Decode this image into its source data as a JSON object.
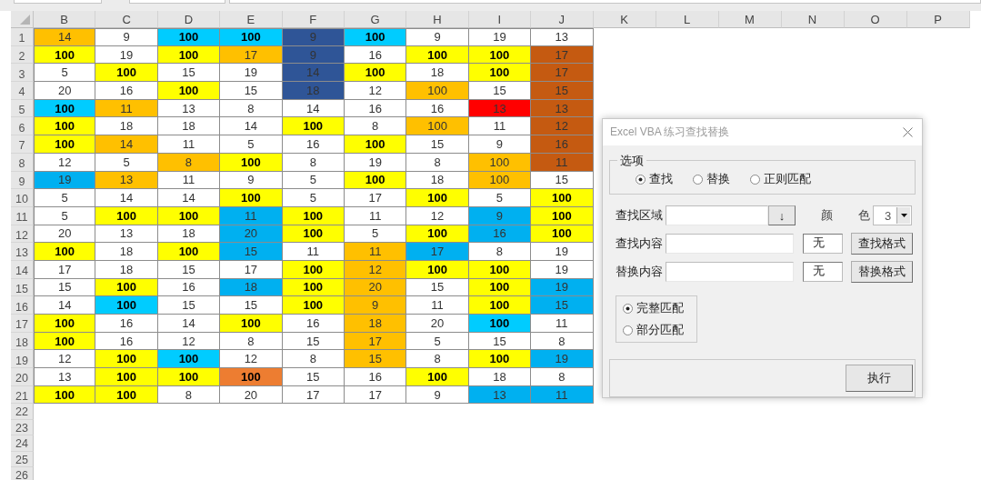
{
  "sheet": {
    "columns": [
      "B",
      "C",
      "D",
      "E",
      "F",
      "G",
      "H",
      "I",
      "J",
      "K",
      "L",
      "M",
      "N",
      "O",
      "P"
    ],
    "row_numbers": [
      "1",
      "2",
      "3",
      "4",
      "5",
      "6",
      "7",
      "8",
      "9",
      "10",
      "11",
      "12",
      "13",
      "14",
      "15",
      "16",
      "17",
      "18",
      "19",
      "20",
      "21",
      "22",
      "23",
      "24",
      "25",
      "26"
    ],
    "rows": [
      [
        {
          "text": "14",
          "color": "#ffc000",
          "bold": false
        },
        {
          "text": "9",
          "color": "#ffffff",
          "bold": false
        },
        {
          "text": "100",
          "color": "#00ccff",
          "bold": true
        },
        {
          "text": "100",
          "color": "#00ccff",
          "bold": true
        },
        {
          "text": "9",
          "color": "#2f5597",
          "bold": false
        },
        {
          "text": "100",
          "color": "#00ccff",
          "bold": true
        },
        {
          "text": "9",
          "color": "#ffffff",
          "bold": false
        },
        {
          "text": "19",
          "color": "#ffffff",
          "bold": false
        },
        {
          "text": "13",
          "color": "#ffffff",
          "bold": false
        }
      ],
      [
        {
          "text": "100",
          "color": "#ffff00",
          "bold": true
        },
        {
          "text": "19",
          "color": "#ffffff",
          "bold": false
        },
        {
          "text": "100",
          "color": "#ffff00",
          "bold": true
        },
        {
          "text": "17",
          "color": "#ffc000",
          "bold": false
        },
        {
          "text": "9",
          "color": "#2f5597",
          "bold": false
        },
        {
          "text": "16",
          "color": "#ffffff",
          "bold": false
        },
        {
          "text": "100",
          "color": "#ffff00",
          "bold": true
        },
        {
          "text": "100",
          "color": "#ffff00",
          "bold": true
        },
        {
          "text": "17",
          "color": "#c55a11",
          "bold": false
        }
      ],
      [
        {
          "text": "5",
          "color": "#ffffff",
          "bold": false
        },
        {
          "text": "100",
          "color": "#ffff00",
          "bold": true
        },
        {
          "text": "15",
          "color": "#ffffff",
          "bold": false
        },
        {
          "text": "19",
          "color": "#ffffff",
          "bold": false
        },
        {
          "text": "14",
          "color": "#2f5597",
          "bold": false
        },
        {
          "text": "100",
          "color": "#ffff00",
          "bold": true
        },
        {
          "text": "18",
          "color": "#ffffff",
          "bold": false
        },
        {
          "text": "100",
          "color": "#ffff00",
          "bold": true
        },
        {
          "text": "17",
          "color": "#c55a11",
          "bold": false
        }
      ],
      [
        {
          "text": "20",
          "color": "#ffffff",
          "bold": false
        },
        {
          "text": "16",
          "color": "#ffffff",
          "bold": false
        },
        {
          "text": "100",
          "color": "#ffff00",
          "bold": true
        },
        {
          "text": "15",
          "color": "#ffffff",
          "bold": false
        },
        {
          "text": "18",
          "color": "#2f5597",
          "bold": false
        },
        {
          "text": "12",
          "color": "#ffffff",
          "bold": false
        },
        {
          "text": "100",
          "color": "#ffc000",
          "bold": false
        },
        {
          "text": "15",
          "color": "#ffffff",
          "bold": false
        },
        {
          "text": "15",
          "color": "#c55a11",
          "bold": false
        }
      ],
      [
        {
          "text": "100",
          "color": "#00ccff",
          "bold": true
        },
        {
          "text": "11",
          "color": "#ffc000",
          "bold": false
        },
        {
          "text": "13",
          "color": "#ffffff",
          "bold": false
        },
        {
          "text": "8",
          "color": "#ffffff",
          "bold": false
        },
        {
          "text": "14",
          "color": "#ffffff",
          "bold": false
        },
        {
          "text": "16",
          "color": "#ffffff",
          "bold": false
        },
        {
          "text": "16",
          "color": "#ffffff",
          "bold": false
        },
        {
          "text": "13",
          "color": "#ff0000",
          "bold": false
        },
        {
          "text": "13",
          "color": "#c55a11",
          "bold": false
        }
      ],
      [
        {
          "text": "100",
          "color": "#ffff00",
          "bold": true
        },
        {
          "text": "18",
          "color": "#ffffff",
          "bold": false
        },
        {
          "text": "18",
          "color": "#ffffff",
          "bold": false
        },
        {
          "text": "14",
          "color": "#ffffff",
          "bold": false
        },
        {
          "text": "100",
          "color": "#ffff00",
          "bold": true
        },
        {
          "text": "8",
          "color": "#ffffff",
          "bold": false
        },
        {
          "text": "100",
          "color": "#ffc000",
          "bold": false
        },
        {
          "text": "11",
          "color": "#ffffff",
          "bold": false
        },
        {
          "text": "12",
          "color": "#c55a11",
          "bold": false
        }
      ],
      [
        {
          "text": "100",
          "color": "#ffff00",
          "bold": true
        },
        {
          "text": "14",
          "color": "#ffc000",
          "bold": false
        },
        {
          "text": "11",
          "color": "#ffffff",
          "bold": false
        },
        {
          "text": "5",
          "color": "#ffffff",
          "bold": false
        },
        {
          "text": "16",
          "color": "#ffffff",
          "bold": false
        },
        {
          "text": "100",
          "color": "#ffff00",
          "bold": true
        },
        {
          "text": "15",
          "color": "#ffffff",
          "bold": false
        },
        {
          "text": "9",
          "color": "#ffffff",
          "bold": false
        },
        {
          "text": "16",
          "color": "#c55a11",
          "bold": false
        }
      ],
      [
        {
          "text": "12",
          "color": "#ffffff",
          "bold": false
        },
        {
          "text": "5",
          "color": "#ffffff",
          "bold": false
        },
        {
          "text": "8",
          "color": "#ffc000",
          "bold": false
        },
        {
          "text": "100",
          "color": "#ffff00",
          "bold": true
        },
        {
          "text": "8",
          "color": "#ffffff",
          "bold": false
        },
        {
          "text": "19",
          "color": "#ffffff",
          "bold": false
        },
        {
          "text": "8",
          "color": "#ffffff",
          "bold": false
        },
        {
          "text": "100",
          "color": "#ffc000",
          "bold": false
        },
        {
          "text": "11",
          "color": "#c55a11",
          "bold": false
        }
      ],
      [
        {
          "text": "19",
          "color": "#00b0f0",
          "bold": false
        },
        {
          "text": "13",
          "color": "#ffc000",
          "bold": false
        },
        {
          "text": "11",
          "color": "#ffffff",
          "bold": false
        },
        {
          "text": "9",
          "color": "#ffffff",
          "bold": false
        },
        {
          "text": "5",
          "color": "#ffffff",
          "bold": false
        },
        {
          "text": "100",
          "color": "#ffff00",
          "bold": true
        },
        {
          "text": "18",
          "color": "#ffffff",
          "bold": false
        },
        {
          "text": "100",
          "color": "#ffc000",
          "bold": false
        },
        {
          "text": "15",
          "color": "#ffffff",
          "bold": false
        }
      ],
      [
        {
          "text": "5",
          "color": "#ffffff",
          "bold": false
        },
        {
          "text": "14",
          "color": "#ffffff",
          "bold": false
        },
        {
          "text": "14",
          "color": "#ffffff",
          "bold": false
        },
        {
          "text": "100",
          "color": "#ffff00",
          "bold": true
        },
        {
          "text": "5",
          "color": "#ffffff",
          "bold": false
        },
        {
          "text": "17",
          "color": "#ffffff",
          "bold": false
        },
        {
          "text": "100",
          "color": "#ffff00",
          "bold": true
        },
        {
          "text": "5",
          "color": "#ffffff",
          "bold": false
        },
        {
          "text": "100",
          "color": "#ffff00",
          "bold": true
        }
      ],
      [
        {
          "text": "5",
          "color": "#ffffff",
          "bold": false
        },
        {
          "text": "100",
          "color": "#ffff00",
          "bold": true
        },
        {
          "text": "100",
          "color": "#ffff00",
          "bold": true
        },
        {
          "text": "11",
          "color": "#00b0f0",
          "bold": false
        },
        {
          "text": "100",
          "color": "#ffff00",
          "bold": true
        },
        {
          "text": "11",
          "color": "#ffffff",
          "bold": false
        },
        {
          "text": "12",
          "color": "#ffffff",
          "bold": false
        },
        {
          "text": "9",
          "color": "#00b0f0",
          "bold": false
        },
        {
          "text": "100",
          "color": "#ffff00",
          "bold": true
        }
      ],
      [
        {
          "text": "20",
          "color": "#ffffff",
          "bold": false
        },
        {
          "text": "13",
          "color": "#ffffff",
          "bold": false
        },
        {
          "text": "18",
          "color": "#ffffff",
          "bold": false
        },
        {
          "text": "20",
          "color": "#00b0f0",
          "bold": false
        },
        {
          "text": "100",
          "color": "#ffff00",
          "bold": true
        },
        {
          "text": "5",
          "color": "#ffffff",
          "bold": false
        },
        {
          "text": "100",
          "color": "#ffff00",
          "bold": true
        },
        {
          "text": "16",
          "color": "#00b0f0",
          "bold": false
        },
        {
          "text": "100",
          "color": "#ffff00",
          "bold": true
        }
      ],
      [
        {
          "text": "100",
          "color": "#ffff00",
          "bold": true
        },
        {
          "text": "18",
          "color": "#ffffff",
          "bold": false
        },
        {
          "text": "100",
          "color": "#ffff00",
          "bold": true
        },
        {
          "text": "15",
          "color": "#00b0f0",
          "bold": false
        },
        {
          "text": "11",
          "color": "#ffffff",
          "bold": false
        },
        {
          "text": "11",
          "color": "#ffc000",
          "bold": false
        },
        {
          "text": "17",
          "color": "#00b0f0",
          "bold": false
        },
        {
          "text": "8",
          "color": "#ffffff",
          "bold": false
        },
        {
          "text": "19",
          "color": "#ffffff",
          "bold": false
        }
      ],
      [
        {
          "text": "17",
          "color": "#ffffff",
          "bold": false
        },
        {
          "text": "18",
          "color": "#ffffff",
          "bold": false
        },
        {
          "text": "15",
          "color": "#ffffff",
          "bold": false
        },
        {
          "text": "17",
          "color": "#ffffff",
          "bold": false
        },
        {
          "text": "100",
          "color": "#ffff00",
          "bold": true
        },
        {
          "text": "12",
          "color": "#ffc000",
          "bold": false
        },
        {
          "text": "100",
          "color": "#ffff00",
          "bold": true
        },
        {
          "text": "100",
          "color": "#ffff00",
          "bold": true
        },
        {
          "text": "19",
          "color": "#ffffff",
          "bold": false
        }
      ],
      [
        {
          "text": "15",
          "color": "#ffffff",
          "bold": false
        },
        {
          "text": "100",
          "color": "#ffff00",
          "bold": true
        },
        {
          "text": "16",
          "color": "#ffffff",
          "bold": false
        },
        {
          "text": "18",
          "color": "#00b0f0",
          "bold": false
        },
        {
          "text": "100",
          "color": "#ffff00",
          "bold": true
        },
        {
          "text": "20",
          "color": "#ffc000",
          "bold": false
        },
        {
          "text": "15",
          "color": "#ffffff",
          "bold": false
        },
        {
          "text": "100",
          "color": "#ffff00",
          "bold": true
        },
        {
          "text": "19",
          "color": "#00b0f0",
          "bold": false
        }
      ],
      [
        {
          "text": "14",
          "color": "#ffffff",
          "bold": false
        },
        {
          "text": "100",
          "color": "#00ccff",
          "bold": true
        },
        {
          "text": "15",
          "color": "#ffffff",
          "bold": false
        },
        {
          "text": "15",
          "color": "#ffffff",
          "bold": false
        },
        {
          "text": "100",
          "color": "#ffff00",
          "bold": true
        },
        {
          "text": "9",
          "color": "#ffc000",
          "bold": false
        },
        {
          "text": "11",
          "color": "#ffffff",
          "bold": false
        },
        {
          "text": "100",
          "color": "#ffff00",
          "bold": true
        },
        {
          "text": "15",
          "color": "#00b0f0",
          "bold": false
        }
      ],
      [
        {
          "text": "100",
          "color": "#ffff00",
          "bold": true
        },
        {
          "text": "16",
          "color": "#ffffff",
          "bold": false
        },
        {
          "text": "14",
          "color": "#ffffff",
          "bold": false
        },
        {
          "text": "100",
          "color": "#ffff00",
          "bold": true
        },
        {
          "text": "16",
          "color": "#ffffff",
          "bold": false
        },
        {
          "text": "18",
          "color": "#ffc000",
          "bold": false
        },
        {
          "text": "20",
          "color": "#ffffff",
          "bold": false
        },
        {
          "text": "100",
          "color": "#00ccff",
          "bold": true
        },
        {
          "text": "11",
          "color": "#ffffff",
          "bold": false
        }
      ],
      [
        {
          "text": "100",
          "color": "#ffff00",
          "bold": true
        },
        {
          "text": "16",
          "color": "#ffffff",
          "bold": false
        },
        {
          "text": "12",
          "color": "#ffffff",
          "bold": false
        },
        {
          "text": "8",
          "color": "#ffffff",
          "bold": false
        },
        {
          "text": "15",
          "color": "#ffffff",
          "bold": false
        },
        {
          "text": "17",
          "color": "#ffc000",
          "bold": false
        },
        {
          "text": "5",
          "color": "#ffffff",
          "bold": false
        },
        {
          "text": "15",
          "color": "#ffffff",
          "bold": false
        },
        {
          "text": "8",
          "color": "#ffffff",
          "bold": false
        }
      ],
      [
        {
          "text": "12",
          "color": "#ffffff",
          "bold": false
        },
        {
          "text": "100",
          "color": "#ffff00",
          "bold": true
        },
        {
          "text": "100",
          "color": "#00ccff",
          "bold": true
        },
        {
          "text": "12",
          "color": "#ffffff",
          "bold": false
        },
        {
          "text": "8",
          "color": "#ffffff",
          "bold": false
        },
        {
          "text": "15",
          "color": "#ffc000",
          "bold": false
        },
        {
          "text": "8",
          "color": "#ffffff",
          "bold": false
        },
        {
          "text": "100",
          "color": "#ffff00",
          "bold": true
        },
        {
          "text": "19",
          "color": "#00b0f0",
          "bold": false
        }
      ],
      [
        {
          "text": "13",
          "color": "#ffffff",
          "bold": false
        },
        {
          "text": "100",
          "color": "#ffff00",
          "bold": true
        },
        {
          "text": "100",
          "color": "#ffff00",
          "bold": true
        },
        {
          "text": "100",
          "color": "#ed7d31",
          "bold": true
        },
        {
          "text": "15",
          "color": "#ffffff",
          "bold": false
        },
        {
          "text": "16",
          "color": "#ffffff",
          "bold": false
        },
        {
          "text": "100",
          "color": "#ffff00",
          "bold": true
        },
        {
          "text": "18",
          "color": "#ffffff",
          "bold": false
        },
        {
          "text": "8",
          "color": "#ffffff",
          "bold": false
        }
      ],
      [
        {
          "text": "100",
          "color": "#ffff00",
          "bold": true
        },
        {
          "text": "100",
          "color": "#ffff00",
          "bold": true
        },
        {
          "text": "8",
          "color": "#ffffff",
          "bold": false
        },
        {
          "text": "20",
          "color": "#ffffff",
          "bold": false
        },
        {
          "text": "17",
          "color": "#ffffff",
          "bold": false
        },
        {
          "text": "17",
          "color": "#ffffff",
          "bold": false
        },
        {
          "text": "9",
          "color": "#ffffff",
          "bold": false
        },
        {
          "text": "13",
          "color": "#00b0f0",
          "bold": false
        },
        {
          "text": "11",
          "color": "#00b0f0",
          "bold": false
        }
      ]
    ]
  },
  "dialog": {
    "title": "Excel VBA 练习查找替换",
    "options_group": {
      "label": "选项",
      "radios": [
        {
          "label": "查找",
          "selected": true
        },
        {
          "label": "替换",
          "selected": false
        },
        {
          "label": "正则匹配",
          "selected": false
        }
      ]
    },
    "find_range": {
      "label": "查找区域",
      "button": "↓"
    },
    "color": {
      "label": "颜 色",
      "value": "3"
    },
    "find_content": {
      "label": "查找内容",
      "format": "无",
      "button": "查找格式"
    },
    "replace_content": {
      "label": "替换内容",
      "format": "无",
      "button": "替换格式"
    },
    "match_group": {
      "radios": [
        {
          "label": "完整匹配",
          "selected": true
        },
        {
          "label": "部分匹配",
          "selected": false
        }
      ]
    },
    "execute_button": "执行"
  }
}
